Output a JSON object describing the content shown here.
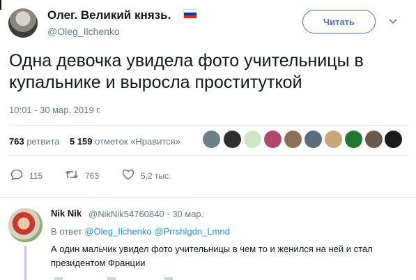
{
  "tweet": {
    "author_name": "Олег. Великий князь.",
    "flag_colors": [
      "#ffffff",
      "#0039a6",
      "#d52b1e"
    ],
    "handle": "@Oleg_Ilchenko",
    "follow_label": "Читать",
    "chevron": "⌄",
    "text": "Одна девочка увидела фото учительницы в купальнике и выросла проституткой",
    "timestamp": "10:01 - 30 мар. 2019 г.",
    "retweet_count": "763",
    "retweet_label": "ретвита",
    "like_count": "5 159",
    "like_label": "отметок «Нравится»",
    "actions": {
      "reply_count": "115",
      "retweet_count": "763",
      "like_count": "5,2 тыс."
    }
  },
  "reply": {
    "author_name": "Nik Nik",
    "handle": "@NikNik54760840",
    "separator": "·",
    "date": "30 мар.",
    "in_reply_prefix": "В ответ",
    "mention_1": "@Oleg_Ilchenko",
    "mention_2": "@Prrshlgdn_Lmnd",
    "text": "А один мальчик увидел фото учительницы в чем то и женился на ней и стал президентом Франции"
  },
  "liker_colors": [
    "#6f7f86",
    "#2f2f2f",
    "#cfe5c8",
    "#b3476a",
    "#8b6f5a",
    "#5a6b7a",
    "#c9a77a",
    "#1e7a2e",
    "#6b5a4a",
    "#1a1a1a"
  ]
}
